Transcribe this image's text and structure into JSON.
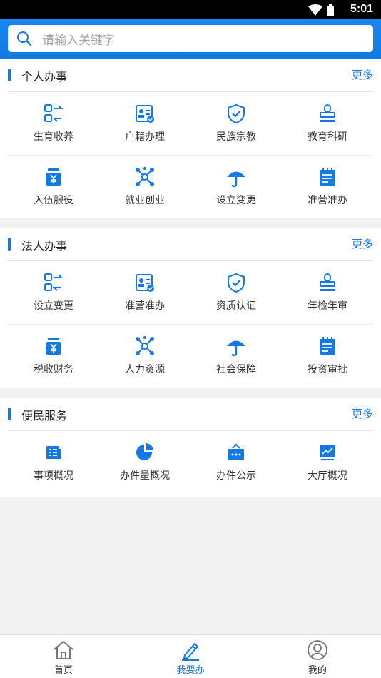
{
  "status_bar": {
    "time": "5:01"
  },
  "search": {
    "placeholder": "请输入关键字"
  },
  "sections": [
    {
      "title": "个人办事",
      "more": "更多",
      "items": [
        {
          "label": "生育收养",
          "icon": "transfer-icon"
        },
        {
          "label": "户籍办理",
          "icon": "id-card-icon"
        },
        {
          "label": "民族宗教",
          "icon": "shield-check-icon"
        },
        {
          "label": "教育科研",
          "icon": "stamp-icon"
        },
        {
          "label": "入伍服役",
          "icon": "yuan-icon"
        },
        {
          "label": "就业创业",
          "icon": "network-icon"
        },
        {
          "label": "设立变更",
          "icon": "umbrella-icon"
        },
        {
          "label": "准营准办",
          "icon": "checklist-icon"
        }
      ]
    },
    {
      "title": "法人办事",
      "more": "更多",
      "items": [
        {
          "label": "设立变更",
          "icon": "transfer-icon"
        },
        {
          "label": "准营准办",
          "icon": "id-card-icon"
        },
        {
          "label": "资质认证",
          "icon": "shield-check-icon"
        },
        {
          "label": "年检年审",
          "icon": "stamp-icon"
        },
        {
          "label": "税收财务",
          "icon": "yuan-icon"
        },
        {
          "label": "人力资源",
          "icon": "network-icon"
        },
        {
          "label": "社会保障",
          "icon": "umbrella-icon"
        },
        {
          "label": "投资审批",
          "icon": "checklist-icon"
        }
      ]
    },
    {
      "title": "便民服务",
      "more": "更多",
      "items": [
        {
          "label": "事项概况",
          "icon": "list-doc-icon"
        },
        {
          "label": "办件量概况",
          "icon": "pie-chart-icon"
        },
        {
          "label": "办件公示",
          "icon": "board-icon"
        },
        {
          "label": "大厅概况",
          "icon": "trend-chart-icon"
        }
      ]
    }
  ],
  "tabs": [
    {
      "label": "首页",
      "icon": "home-icon",
      "active": false
    },
    {
      "label": "我要办",
      "icon": "pencil-icon",
      "active": true
    },
    {
      "label": "我的",
      "icon": "user-icon",
      "active": false
    }
  ],
  "colors": {
    "accent": "#1479e6",
    "background": "#f2f2f2"
  }
}
